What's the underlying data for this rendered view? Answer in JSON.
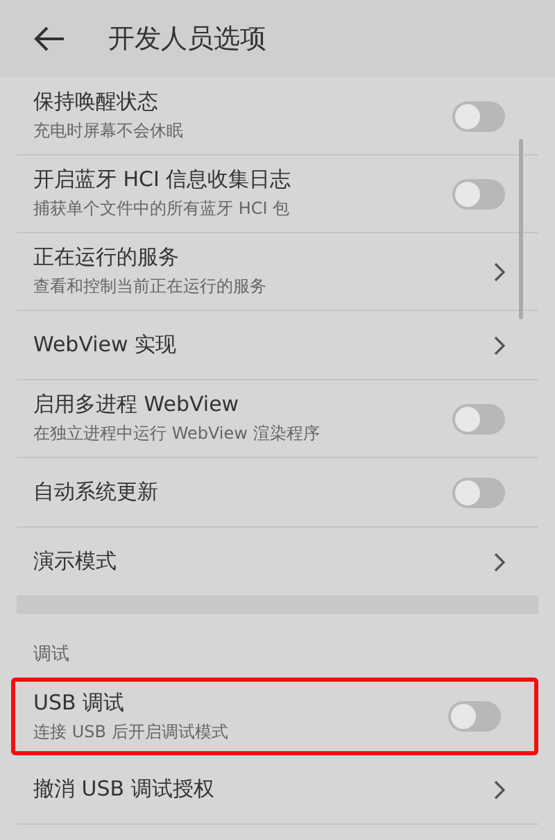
{
  "header": {
    "title": "开发人员选项"
  },
  "sections": [
    {
      "items": [
        {
          "kind": "toggle",
          "title": "保持唤醒状态",
          "subtitle": "充电时屏幕不会休眠",
          "on": false,
          "highlighted": false
        },
        {
          "kind": "toggle",
          "title": "开启蓝牙 HCI 信息收集日志",
          "subtitle": "捕获单个文件中的所有蓝牙 HCI 包",
          "on": false,
          "highlighted": false
        },
        {
          "kind": "link",
          "title": "正在运行的服务",
          "subtitle": "查看和控制当前正在运行的服务",
          "highlighted": false
        },
        {
          "kind": "link",
          "title": "WebView 实现",
          "highlighted": false
        },
        {
          "kind": "toggle",
          "title": "启用多进程 WebView",
          "subtitle": "在独立进程中运行 WebView 渲染程序",
          "on": false,
          "highlighted": false
        },
        {
          "kind": "toggle",
          "title": "自动系统更新",
          "on": false,
          "highlighted": false
        },
        {
          "kind": "link",
          "title": "演示模式",
          "highlighted": false
        }
      ]
    },
    {
      "title": "调试",
      "items": [
        {
          "kind": "toggle",
          "title": "USB 调试",
          "subtitle": "连接 USB 后开启调试模式",
          "on": false,
          "highlighted": true
        },
        {
          "kind": "link",
          "title": "撤消 USB 调试授权",
          "highlighted": false
        }
      ]
    }
  ]
}
